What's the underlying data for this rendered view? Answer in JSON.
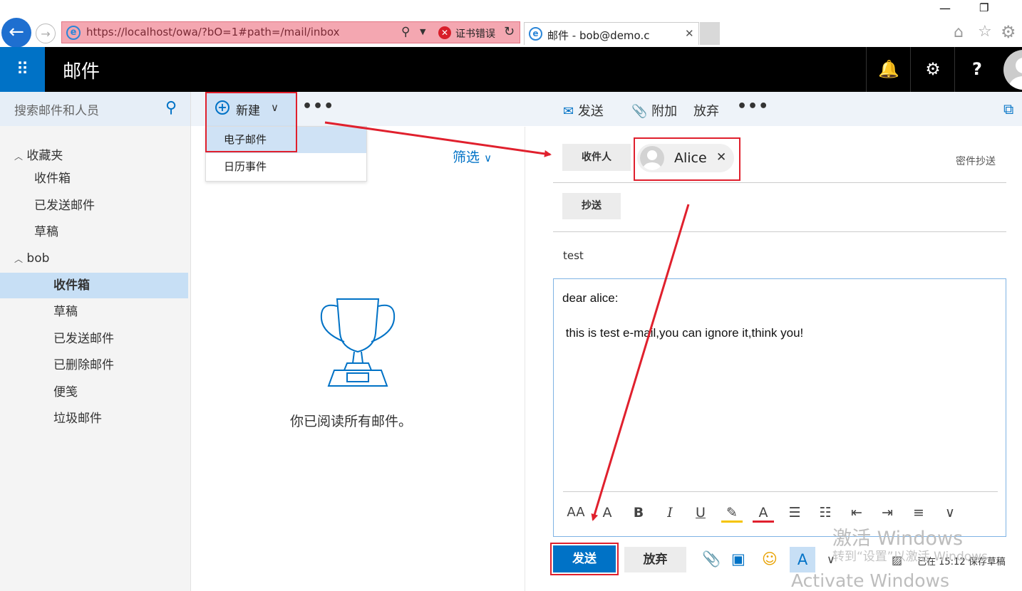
{
  "browser": {
    "url": "https://localhost/owa/?bO=1#path=/mail/inbox",
    "cert_error": "证书错误",
    "tab_title": "邮件 - bob@demo.c"
  },
  "header": {
    "app_title": "邮件"
  },
  "nav": {
    "search_placeholder": "搜索邮件和人员",
    "favorites_label": "收藏夹",
    "favorites": [
      "收件箱",
      "已发送邮件",
      "草稿"
    ],
    "account_label": "bob",
    "folders": [
      "收件箱",
      "草稿",
      "已发送邮件",
      "已删除邮件",
      "便笺",
      "垃圾邮件"
    ]
  },
  "command": {
    "new_label": "新建",
    "send": "发送",
    "attach": "附加",
    "discard": "放弃",
    "menu_items": [
      "电子邮件",
      "日历事件"
    ]
  },
  "list": {
    "filter": "筛选",
    "empty_message": "你已阅读所有邮件。"
  },
  "compose": {
    "to_button": "收件人",
    "recipient": "Alice",
    "cc_button": "抄送",
    "bcc_link": "密件抄送",
    "subject": "test",
    "body_line1": "dear alice:",
    "body_line2": " this is test e-mail,you can ignore it,think you!",
    "send_button": "发送",
    "discard_button": "放弃",
    "saved_status": "已在 15:12 保存草稿"
  },
  "watermark": {
    "line1": "激活 Windows",
    "line2": "转到“设置”以激活 Windows",
    "line3": "Activate Windows"
  },
  "colors": {
    "accent": "#0072c6",
    "annotation": "#e0202d",
    "selected": "#c7dff5"
  }
}
